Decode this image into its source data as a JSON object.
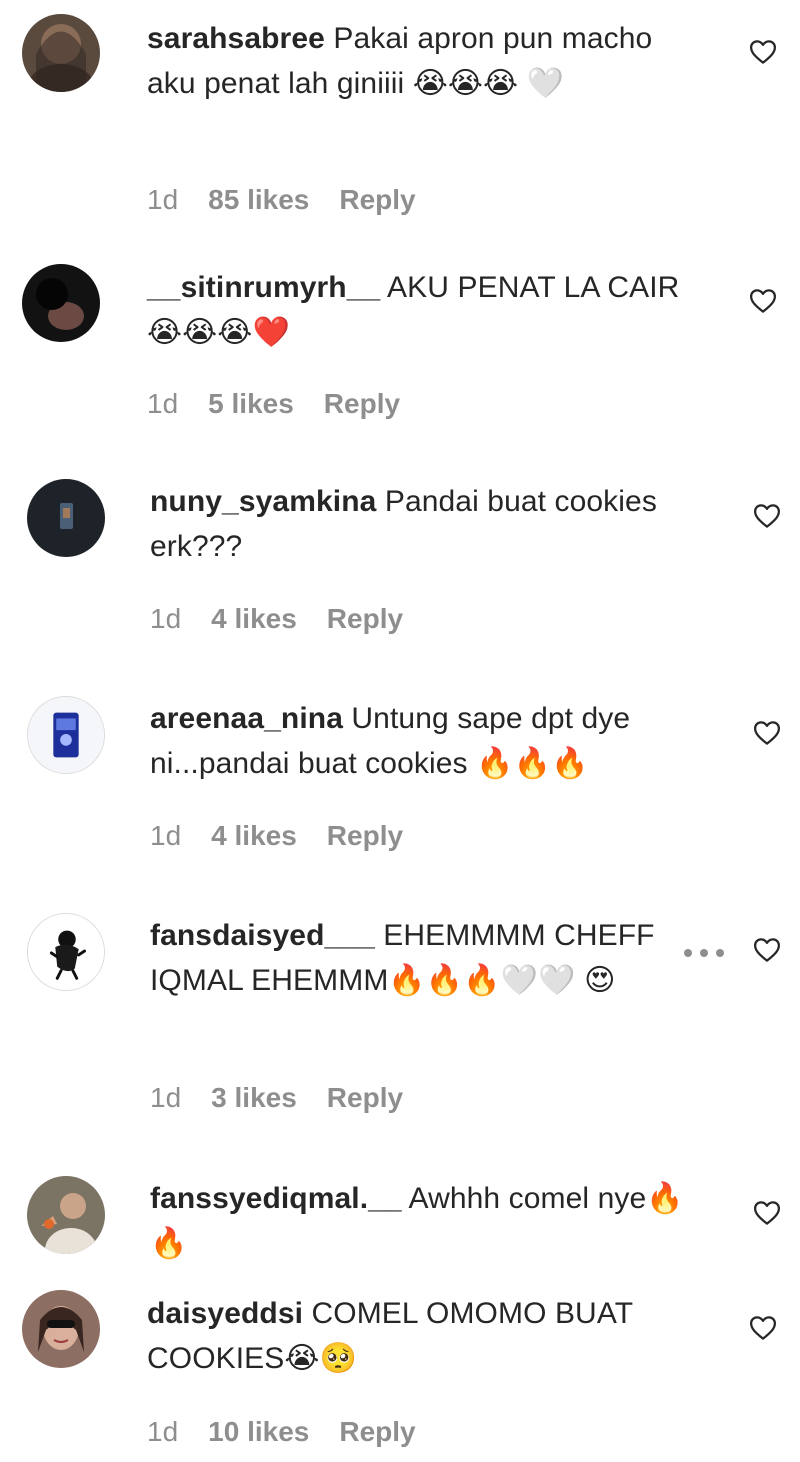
{
  "comments": [
    {
      "username": "sarahsabree",
      "text": " Pakai apron pun macho aku penat lah giniiii 😭😭😭 🤍",
      "time": "1d",
      "likes": "85 likes",
      "reply": "Reply",
      "avatar_icon": "profile-photo-woman-hijab"
    },
    {
      "username": "__sitinrumyrh__",
      "text": " AKU PENAT LA CAIR 😭😭😭❤️",
      "time": "1d",
      "likes": "5 likes",
      "reply": "Reply",
      "avatar_icon": "profile-photo-dark"
    },
    {
      "username": "nuny_syamkina",
      "text": " Pandai buat cookies erk???",
      "time": "1d",
      "likes": "4 likes",
      "reply": "Reply",
      "avatar_icon": "profile-photo-dark-square"
    },
    {
      "username": "areenaa_nina",
      "text": " Untung sape dpt dye ni...pandai buat cookies 🔥🔥🔥",
      "time": "1d",
      "likes": "4 likes",
      "reply": "Reply",
      "avatar_icon": "profile-photo-blue"
    },
    {
      "username": "fansdaisyed___",
      "text": " EHEMMMM CHEFF IQMAL EHEMMM🔥🔥🔥🤍🤍 😍",
      "time": "1d",
      "likes": "3 likes",
      "reply": "Reply",
      "avatar_icon": "profile-photo-sketch",
      "more_icon": "more-options-icon"
    },
    {
      "username": "fanssyediqmal.__",
      "text": " Awhhh comel nye🔥🔥",
      "time": "",
      "likes": "",
      "reply": "",
      "avatar_icon": "profile-photo-man"
    },
    {
      "username": "daisyeddsi",
      "text": " COMEL OMOMO BUAT COOKIES😭🥺",
      "time": "1d",
      "likes": "10 likes",
      "reply": "Reply",
      "avatar_icon": "profile-photo-woman-sunglasses"
    }
  ],
  "colors": {
    "text": "#262626",
    "secondary": "#8e8e8e",
    "background": "#ffffff"
  },
  "icons": {
    "like": "heart-outline-icon"
  }
}
